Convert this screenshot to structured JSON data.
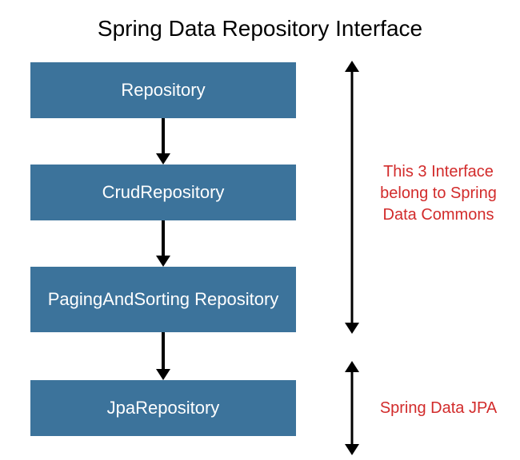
{
  "title": "Spring Data Repository Interface",
  "boxes": {
    "repository": "Repository",
    "crud": "CrudRepository",
    "paging": "PagingAndSorting Repository",
    "jpa": "JpaRepository"
  },
  "annotations": {
    "commons": "This 3 Interface belong to Spring Data Commons",
    "jpa": "Spring Data JPA"
  }
}
